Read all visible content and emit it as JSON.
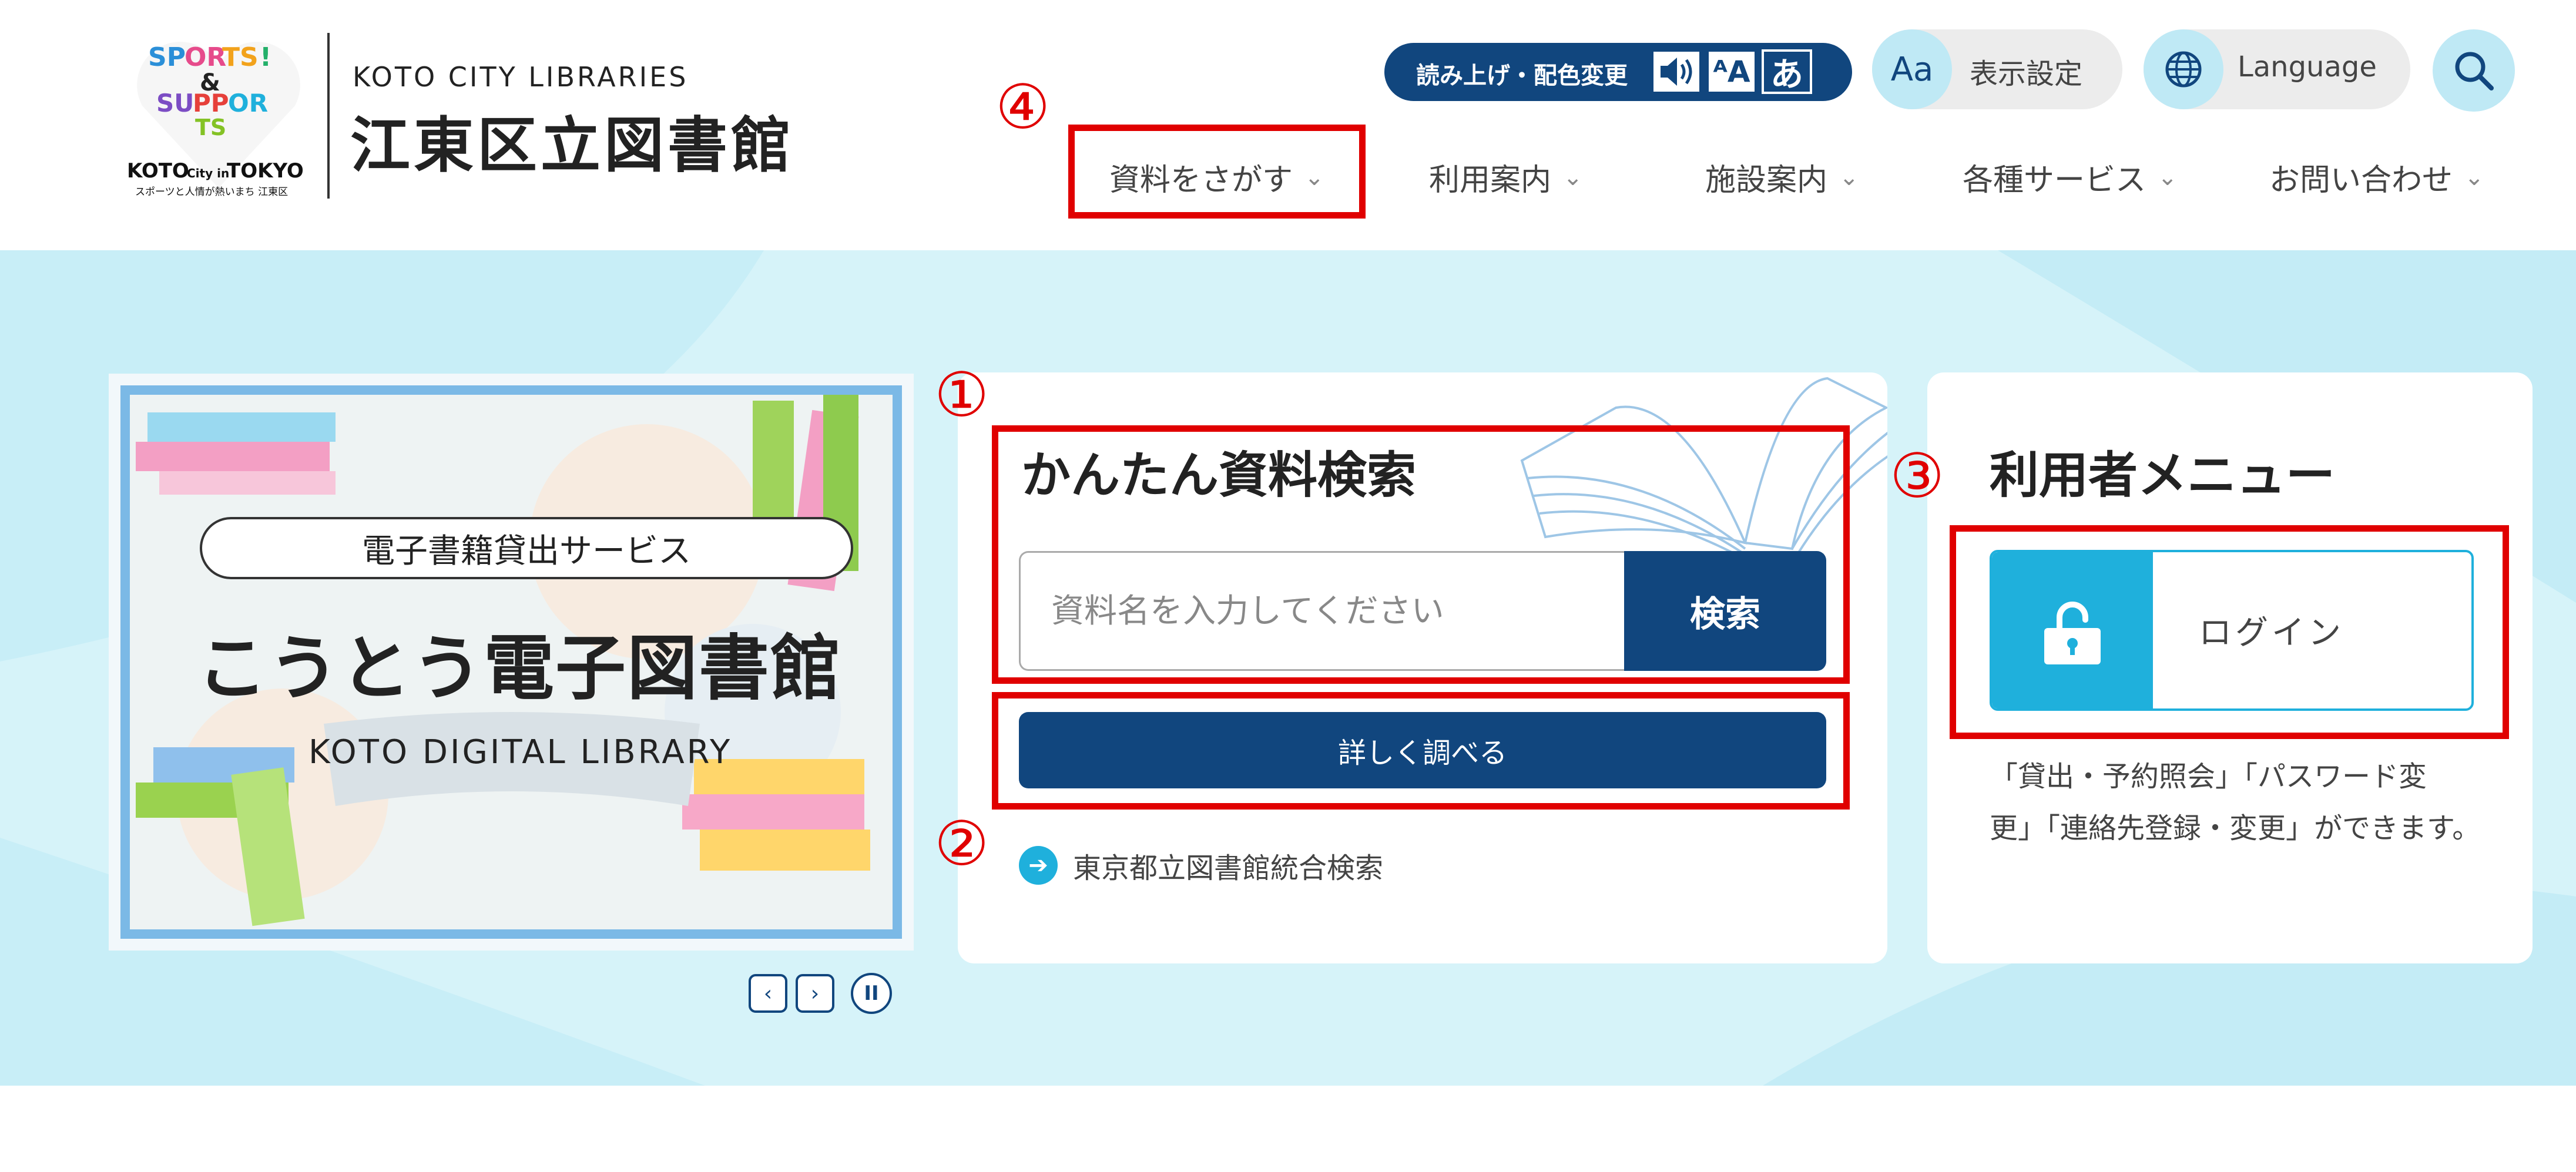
{
  "header": {
    "logo_sub": "KOTO CITY LIBRARIES",
    "logo_main": "江東区立図書館",
    "logo_mark_text": "SPORTS & SUPPORTS KOTO City in TOKYO スポーツと人情が熱いまち 江東区",
    "read_aloud_label": "読み上げ・配色変更",
    "read_icons": [
      "speaker-icon",
      "text-spacing-icon",
      "hiragana-icon"
    ],
    "read_icon_glyphs": [
      "🔊",
      "ᴬA",
      "あ"
    ],
    "display_icon_text": "Aa",
    "display_label": "表示設定",
    "language_label": "Language",
    "search_icon": "search-icon"
  },
  "nav": {
    "items": [
      {
        "label": "資料をさがす"
      },
      {
        "label": "利用案内"
      },
      {
        "label": "施設案内"
      },
      {
        "label": "各種サービス"
      },
      {
        "label": "お問い合わせ"
      }
    ],
    "chevron": "⌄"
  },
  "banner": {
    "bubble_text": "電子書籍貸出サービス",
    "title": "こうとう電子図書館",
    "subtitle": "KOTO DIGITAL LIBRARY",
    "prev": "‹",
    "next": "›",
    "pause": "II"
  },
  "search": {
    "title": "かんたん資料検索",
    "placeholder": "資料名を入力してください",
    "submit_label": "検索",
    "detail_label": "詳しく調べる",
    "tokyo_link": "東京都立図書館統合検索",
    "arrow": "➔"
  },
  "user_menu": {
    "title": "利用者メニュー",
    "login_label": "ログイン",
    "description": "「貸出・予約照会」「パスワード変更」「連絡先登録・変更」ができます。"
  },
  "annotations": {
    "marks": [
      "①",
      "②",
      "③",
      "④"
    ],
    "color": "#e00000"
  },
  "colors": {
    "navy": "#11467e",
    "cyan": "#1fb0dc",
    "hero_bg": "#d6f3f9",
    "light_cyan": "#bfe9f5"
  }
}
